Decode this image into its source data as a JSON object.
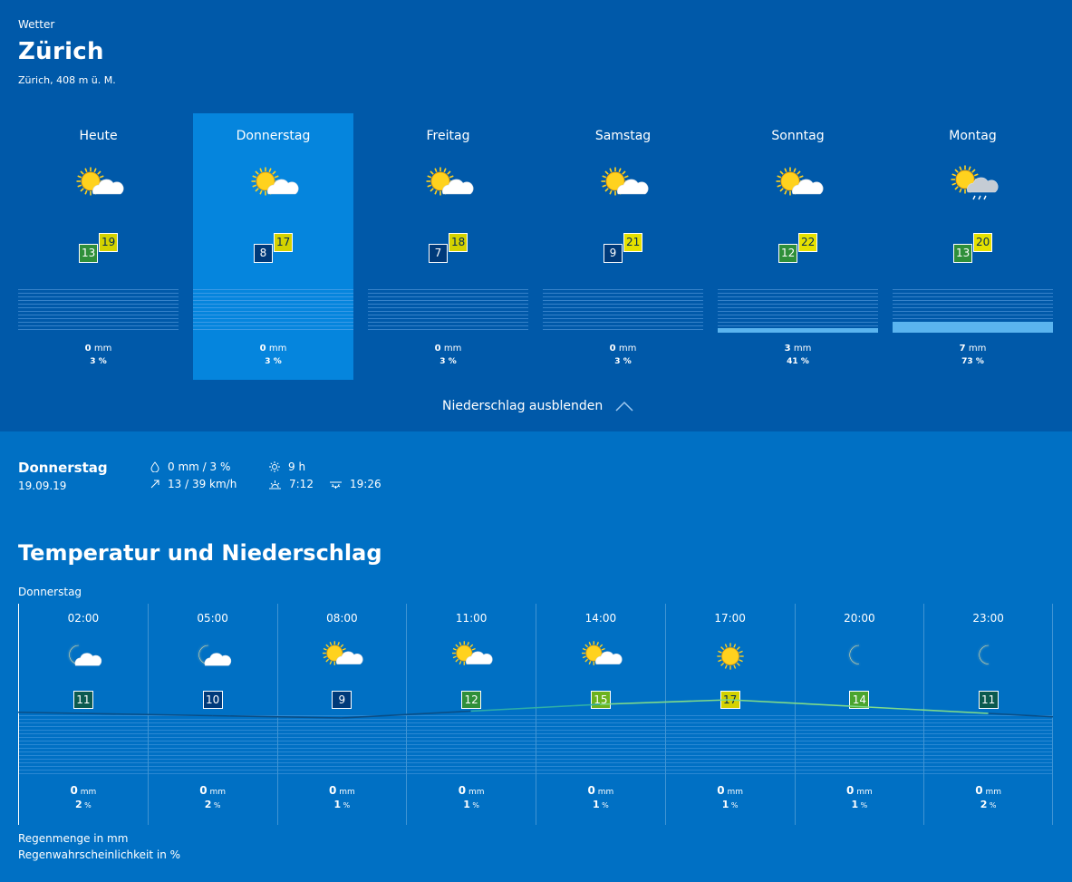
{
  "breadcrumb": "Wetter",
  "city": "Zürich",
  "location": "Zürich, 408 m ü. M.",
  "days": [
    {
      "name": "Heute",
      "icon": "sun-cloud-icon",
      "min": "13",
      "max": "19",
      "min_color": "#2f8f3a",
      "max_color": "#d4d200",
      "mm": "0",
      "unit_mm": "mm",
      "pct": "3",
      "unit_pct": "%",
      "rain_fraction": 0
    },
    {
      "name": "Donnerstag",
      "icon": "sun-cloud-icon",
      "min": "8",
      "max": "17",
      "min_color": "#003a7a",
      "max_color": "#d4d200",
      "mm": "0",
      "unit_mm": "mm",
      "pct": "3",
      "unit_pct": "%",
      "rain_fraction": 0,
      "selected": true
    },
    {
      "name": "Freitag",
      "icon": "sun-cloud-icon",
      "min": "7",
      "max": "18",
      "min_color": "#003a7a",
      "max_color": "#d4d200",
      "mm": "0",
      "unit_mm": "mm",
      "pct": "3",
      "unit_pct": "%",
      "rain_fraction": 0
    },
    {
      "name": "Samstag",
      "icon": "sun-cloud-icon",
      "min": "9",
      "max": "21",
      "min_color": "#003a7a",
      "max_color": "#e6e100",
      "mm": "0",
      "unit_mm": "mm",
      "pct": "3",
      "unit_pct": "%",
      "rain_fraction": 0
    },
    {
      "name": "Sonntag",
      "icon": "sun-cloud-icon",
      "min": "12",
      "max": "22",
      "min_color": "#2f8f3a",
      "max_color": "#e6e100",
      "mm": "3",
      "unit_mm": "mm",
      "pct": "41",
      "unit_pct": "%",
      "rain_fraction": 0.1
    },
    {
      "name": "Montag",
      "icon": "sun-cloud-rain-icon",
      "min": "13",
      "max": "20",
      "min_color": "#2f8f3a",
      "max_color": "#e6e100",
      "mm": "7",
      "unit_mm": "mm",
      "pct": "73",
      "unit_pct": "%",
      "rain_fraction": 0.25
    }
  ],
  "toggle_label": "Niederschlag ausblenden",
  "detail": {
    "day": "Donnerstag",
    "date": "19.09.19",
    "rain": "0 mm / 3 %",
    "wind": "13 / 39 km/h",
    "sunshine": "9 h",
    "sunrise": "7:12",
    "sunset": "19:26"
  },
  "section_title": "Temperatur und Niederschlag",
  "hourly_day": "Donnerstag",
  "hours": [
    {
      "time": "02:00",
      "icon": "moon-cloud-icon",
      "temp": "11",
      "color": "#0b5a4f",
      "mm": "0",
      "unit_mm": "mm",
      "pct": "2",
      "unit_pct": "%"
    },
    {
      "time": "05:00",
      "icon": "moon-cloud-icon",
      "temp": "10",
      "color": "#003a7a",
      "mm": "0",
      "unit_mm": "mm",
      "pct": "2",
      "unit_pct": "%"
    },
    {
      "time": "08:00",
      "icon": "sun-cloud-icon",
      "temp": "9",
      "color": "#003a7a",
      "mm": "0",
      "unit_mm": "mm",
      "pct": "1",
      "unit_pct": "%"
    },
    {
      "time": "11:00",
      "icon": "sun-cloud-icon",
      "temp": "12",
      "color": "#2f8f3a",
      "mm": "0",
      "unit_mm": "mm",
      "pct": "1",
      "unit_pct": "%"
    },
    {
      "time": "14:00",
      "icon": "sun-cloud-icon",
      "temp": "15",
      "color": "#6cb21e",
      "mm": "0",
      "unit_mm": "mm",
      "pct": "1",
      "unit_pct": "%"
    },
    {
      "time": "17:00",
      "icon": "sun-icon",
      "temp": "17",
      "color": "#d4d200",
      "mm": "0",
      "unit_mm": "mm",
      "pct": "1",
      "unit_pct": "%"
    },
    {
      "time": "20:00",
      "icon": "moon-icon",
      "temp": "14",
      "color": "#4aa52e",
      "mm": "0",
      "unit_mm": "mm",
      "pct": "1",
      "unit_pct": "%"
    },
    {
      "time": "23:00",
      "icon": "moon-icon",
      "temp": "11",
      "color": "#0b5a4f",
      "mm": "0",
      "unit_mm": "mm",
      "pct": "2",
      "unit_pct": "%"
    }
  ],
  "legend": {
    "rain_amount": "Regenmenge in mm",
    "rain_probability": "Regenwahrscheinlichkeit in %"
  }
}
